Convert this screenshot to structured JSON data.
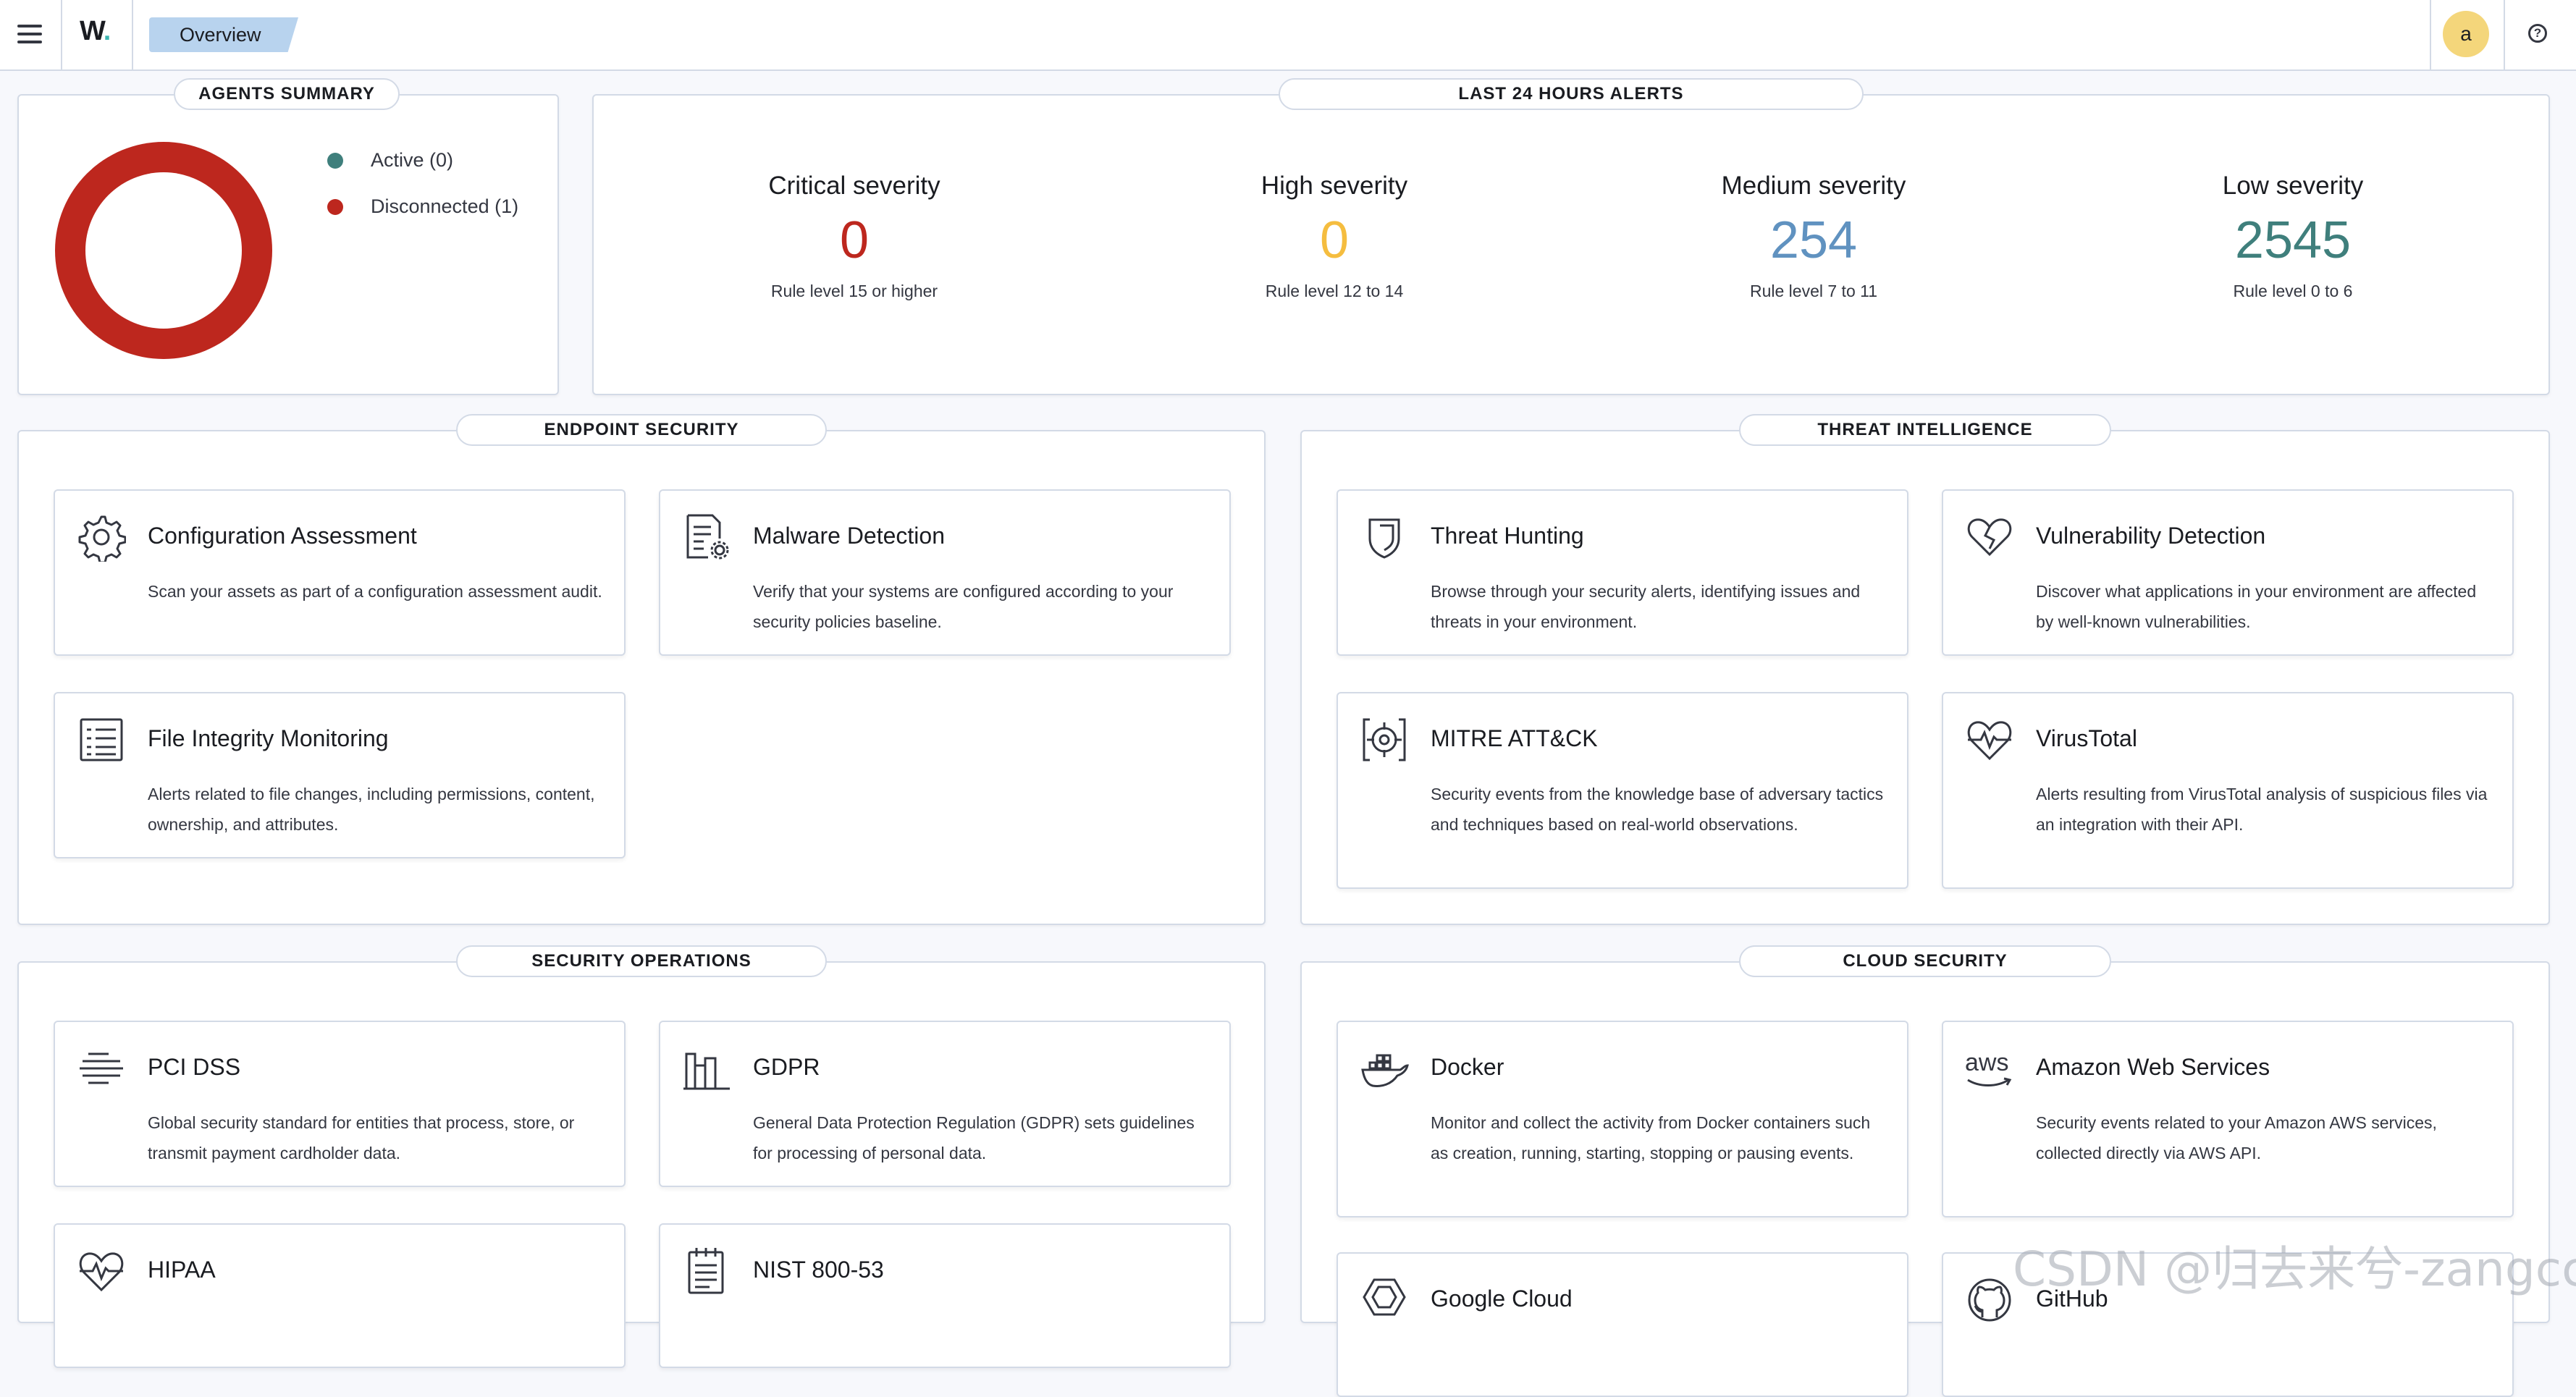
{
  "header": {
    "logo": "W",
    "breadcrumb": "Overview",
    "avatar_letter": "a"
  },
  "agents_summary": {
    "title": "AGENTS SUMMARY",
    "legend": [
      {
        "label": "Active (0)",
        "color": "#3f7f7c",
        "count": 0
      },
      {
        "label": "Disconnected (1)",
        "color": "#bd271e",
        "count": 1
      }
    ]
  },
  "alerts": {
    "title": "LAST 24 HOURS ALERTS",
    "severities": [
      {
        "title": "Critical severity",
        "count": "0",
        "subtitle": "Rule level 15 or higher",
        "color": "#bd271e"
      },
      {
        "title": "High severity",
        "count": "0",
        "subtitle": "Rule level 12 to 14",
        "color": "#f5bd3f"
      },
      {
        "title": "Medium severity",
        "count": "254",
        "subtitle": "Rule level 7 to 11",
        "color": "#6092c0"
      },
      {
        "title": "Low severity",
        "count": "2545",
        "subtitle": "Rule level 0 to 6",
        "color": "#3f7f7c"
      }
    ]
  },
  "endpoint": {
    "title": "ENDPOINT SECURITY",
    "cards": [
      {
        "title": "Configuration Assessment",
        "desc": "Scan your assets as part of a configuration assessment audit.",
        "icon": "gear-icon"
      },
      {
        "title": "Malware Detection",
        "desc": "Verify that your systems are configured according to your security policies baseline.",
        "icon": "document-gear-icon"
      },
      {
        "title": "File Integrity Monitoring",
        "desc": "Alerts related to file changes, including permissions, content, ownership, and attributes.",
        "icon": "list-document-icon"
      }
    ]
  },
  "threat": {
    "title": "THREAT INTELLIGENCE",
    "cards": [
      {
        "title": "Threat Hunting",
        "desc": "Browse through your security alerts, identifying issues and threats in your environment.",
        "icon": "shield-icon"
      },
      {
        "title": "Vulnerability Detection",
        "desc": "Discover what applications in your environment are affected by well-known vulnerabilities.",
        "icon": "broken-heart-icon"
      },
      {
        "title": "MITRE ATT&CK",
        "desc": "Security events from the knowledge base of adversary tactics and techniques based on real-world observations.",
        "icon": "crosshair-icon"
      },
      {
        "title": "VirusTotal",
        "desc": "Alerts resulting from VirusTotal analysis of suspicious files via an integration with their API.",
        "icon": "heartbeat-icon"
      }
    ]
  },
  "secops": {
    "title": "SECURITY OPERATIONS",
    "cards": [
      {
        "title": "PCI DSS",
        "desc": "Global security standard for entities that process, store, or transmit payment cardholder data.",
        "icon": "lines-icon"
      },
      {
        "title": "GDPR",
        "desc": "General Data Protection Regulation (GDPR) sets guidelines for processing of personal data.",
        "icon": "building-icon"
      },
      {
        "title": "HIPAA",
        "desc": "",
        "icon": "heartbeat-icon"
      },
      {
        "title": "NIST 800-53",
        "desc": "",
        "icon": "notepad-icon"
      }
    ]
  },
  "cloud": {
    "title": "CLOUD SECURITY",
    "cards": [
      {
        "title": "Docker",
        "desc": "Monitor and collect the activity from Docker containers such as creation, running, starting, stopping or pausing events.",
        "icon": "docker-icon"
      },
      {
        "title": "Amazon Web Services",
        "desc": "Security events related to your Amazon AWS services, collected directly via AWS API.",
        "icon": "aws-icon"
      },
      {
        "title": "Google Cloud",
        "desc": "",
        "icon": "google-cloud-icon"
      },
      {
        "title": "GitHub",
        "desc": "",
        "icon": "github-icon"
      }
    ],
    "aws_logo_text": "aws"
  },
  "watermark": "CSDN @归去来兮-zangcc"
}
